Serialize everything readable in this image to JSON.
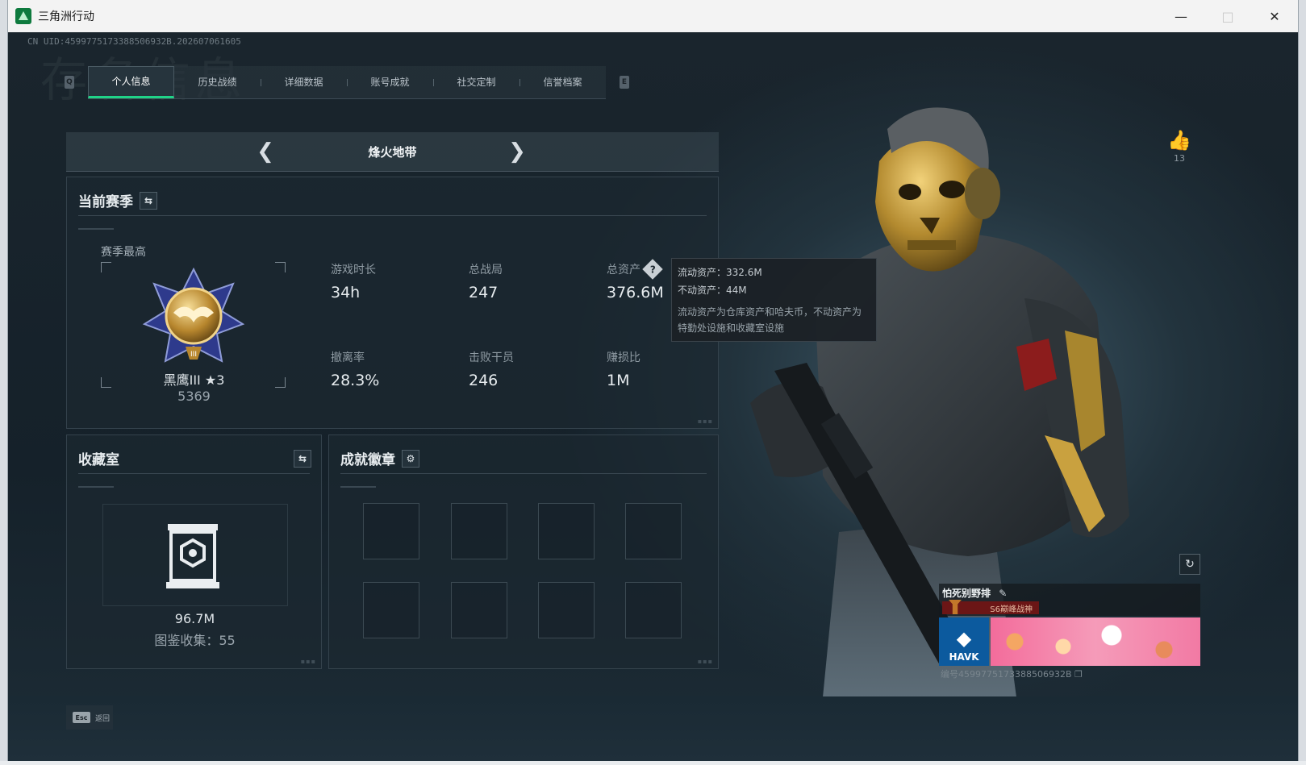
{
  "window": {
    "title": "三角洲行动"
  },
  "uid": "CN UID:4599775173388506932B.202607061605",
  "bg_watermark": "存名信息",
  "tabs": {
    "left_key": "Q",
    "right_key": "E",
    "items": [
      {
        "label": "个人信息",
        "active": true
      },
      {
        "label": "历史战绩"
      },
      {
        "label": "详细数据"
      },
      {
        "label": "账号成就"
      },
      {
        "label": "社交定制"
      },
      {
        "label": "信誉档案"
      }
    ]
  },
  "map": {
    "name": "烽火地带"
  },
  "season": {
    "title": "当前赛季",
    "peak_label": "赛季最高",
    "rank_name": "黑鹰III ★3",
    "rank_score": "5369",
    "stats": [
      {
        "label": "游戏时长",
        "value": "34h"
      },
      {
        "label": "总战局",
        "value": "247"
      },
      {
        "label": "总资产",
        "value": "376.6M",
        "help": "?"
      },
      {
        "label": "撤离率",
        "value": "28.3%"
      },
      {
        "label": "击败干员",
        "value": "246"
      },
      {
        "label": "赚损比",
        "value": "1M"
      }
    ]
  },
  "tooltip": {
    "liquid": "流动资产：332.6M",
    "fixed": "不动资产：44M",
    "note": "流动资产为仓库资产和哈夫币，不动资产为特勤处设施和收藏室设施"
  },
  "collection": {
    "title": "收藏室",
    "value": "96.7M",
    "count": "图鉴收集：55"
  },
  "achievements": {
    "title": "成就徽章"
  },
  "like": {
    "count": "13"
  },
  "nameplate": {
    "name": "怕死别野排",
    "tag": "S6巅峰战神",
    "logo": "HAVK",
    "id": "编号4599775173388506932B"
  },
  "bottom": {
    "esc_key": "Esc",
    "esc_label": "返回"
  },
  "colors": {
    "accent": "#1fd387"
  }
}
